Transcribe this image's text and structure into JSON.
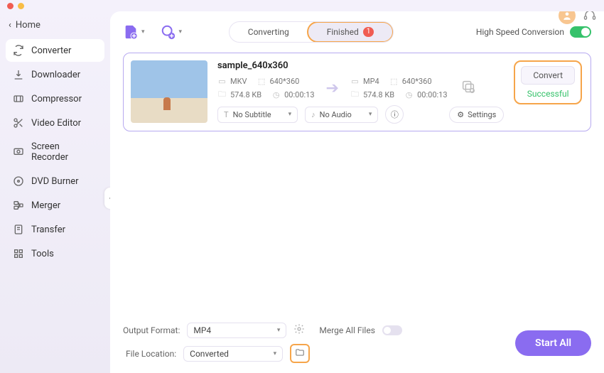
{
  "header": {
    "home_label": "Home",
    "converting_label": "Converting",
    "finished_label": "Finished",
    "finished_count": "1",
    "high_speed_label": "High Speed Conversion"
  },
  "sidebar": {
    "items": [
      {
        "label": "Converter"
      },
      {
        "label": "Downloader"
      },
      {
        "label": "Compressor"
      },
      {
        "label": "Video Editor"
      },
      {
        "label": "Screen Recorder"
      },
      {
        "label": "DVD Burner"
      },
      {
        "label": "Merger"
      },
      {
        "label": "Transfer"
      },
      {
        "label": "Tools"
      }
    ]
  },
  "file": {
    "name": "sample_640x360",
    "src": {
      "format": "MKV",
      "dimensions": "640*360",
      "size": "574.8 KB",
      "duration": "00:00:13"
    },
    "dst": {
      "format": "MP4",
      "dimensions": "640*360",
      "size": "574.8 KB",
      "duration": "00:00:13"
    },
    "subtitle_option": "No Subtitle",
    "audio_option": "No Audio",
    "settings_label": "Settings",
    "convert_label": "Convert",
    "status_label": "Successful"
  },
  "footer": {
    "output_format_label": "Output Format:",
    "output_format_value": "MP4",
    "file_location_label": "File Location:",
    "file_location_value": "Converted",
    "merge_label": "Merge All Files",
    "start_all_label": "Start All"
  }
}
